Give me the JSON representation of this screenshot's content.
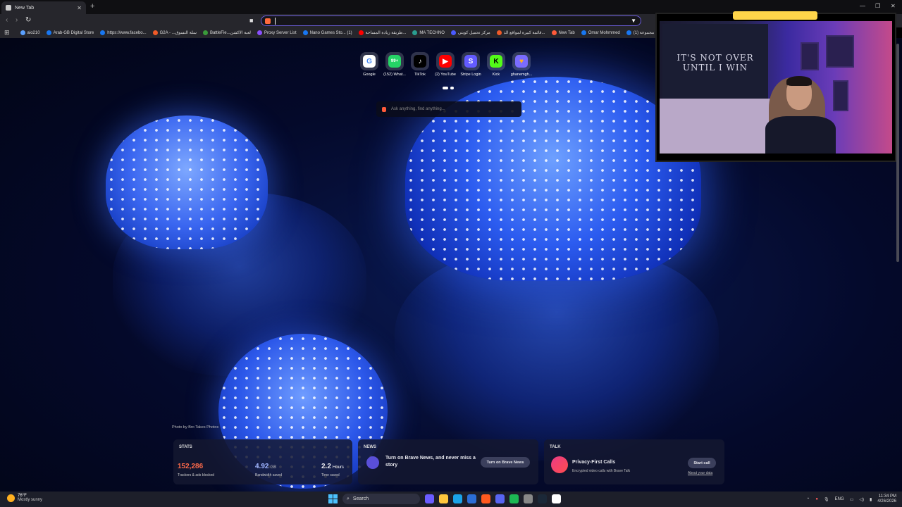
{
  "browser": {
    "tab_title": "New Tab",
    "new_tab": "+",
    "window_controls": [
      "—",
      "❐",
      "✕"
    ]
  },
  "bookmarks": [
    {
      "label": "aio210",
      "color": "#5aa0ff"
    },
    {
      "label": "Arab-GB Digital Store",
      "color": "#1877f2"
    },
    {
      "label": "https://www.facebo...",
      "color": "#1877f2"
    },
    {
      "label": "G2A - ...سلة التسوق",
      "color": "#f05a28"
    },
    {
      "label": "BattleFie...لعبة الاكشن",
      "color": "#3a9b3a"
    },
    {
      "label": "Proxy Server List",
      "color": "#8a4fff"
    },
    {
      "label": "Nano Games Sto... (1)",
      "color": "#1877f2"
    },
    {
      "label": "طريقة زيادة المساحة...",
      "color": "#ff0000"
    },
    {
      "label": "MA TECHNO",
      "color": "#2a9d8f"
    },
    {
      "label": "مركز تحميل كويتي",
      "color": "#4a5aff"
    },
    {
      "label": "قائمة كبيرة لمواقع الذ...",
      "color": "#f05a28"
    },
    {
      "label": "New Tab",
      "color": "#ff5a3a"
    },
    {
      "label": "Omar Mohmmed",
      "color": "#1877f2"
    },
    {
      "label": "(1) مجموعة ...",
      "color": "#1877f2"
    }
  ],
  "top_sites": [
    {
      "label": "Google",
      "glyph": "G",
      "bg": "#ffffff",
      "fg": "#4285f4"
    },
    {
      "label": "(152) What...",
      "glyph": "99+",
      "bg": "#25d366",
      "fg": "#ffffff"
    },
    {
      "label": "TikTok",
      "glyph": "♪",
      "bg": "#000000",
      "fg": "#ffffff"
    },
    {
      "label": "(2) YouTube",
      "glyph": "▶",
      "bg": "#ff0000",
      "fg": "#ffffff"
    },
    {
      "label": "Stripe Login",
      "glyph": "S",
      "bg": "#635bff",
      "fg": "#ffffff"
    },
    {
      "label": "Kick",
      "glyph": "K",
      "bg": "#53fc18",
      "fg": "#000000"
    },
    {
      "label": "ghanemgh...",
      "glyph": "♥",
      "bg": "#7a6cff",
      "fg": "#ffb020"
    }
  ],
  "ask": {
    "placeholder": "Ask anything, find anything..."
  },
  "photo_credit": "Photo by Bro Takes Photos",
  "stats": {
    "title": "STATS",
    "trackers": {
      "value": "152,286",
      "desc": "Trackers & ads blocked"
    },
    "bandwidth": {
      "value": "4.92",
      "unit": "GB",
      "desc": "Bandwidth saved"
    },
    "time": {
      "value": "2.2",
      "unit": "Hours",
      "desc": "Time saved"
    }
  },
  "news": {
    "title": "NEWS",
    "text": "Turn on Brave News, and never miss a story",
    "button": "Turn on Brave News"
  },
  "talk": {
    "title": "TALK",
    "heading": "Privacy-First Calls",
    "sub": "Encrypted video calls with Brave Talk",
    "button": "Start call",
    "link": "About your data"
  },
  "webcam": {
    "banner_line1": "IT'S NOT OVER",
    "banner_line2": "UNTIL I WIN"
  },
  "taskbar": {
    "weather_temp": "76°F",
    "weather_desc": "Mostly sunny",
    "search": "Search",
    "apps": [
      "#6a5cff",
      "#ffc83d",
      "#1aa3e8",
      "#2b6ed6",
      "#ff5a1f",
      "#5865f2",
      "#1db954",
      "#888888",
      "#1b2838",
      "#ffffff"
    ],
    "lang": "ENG",
    "time": "11:34 PM",
    "date": "4/26/2026"
  }
}
